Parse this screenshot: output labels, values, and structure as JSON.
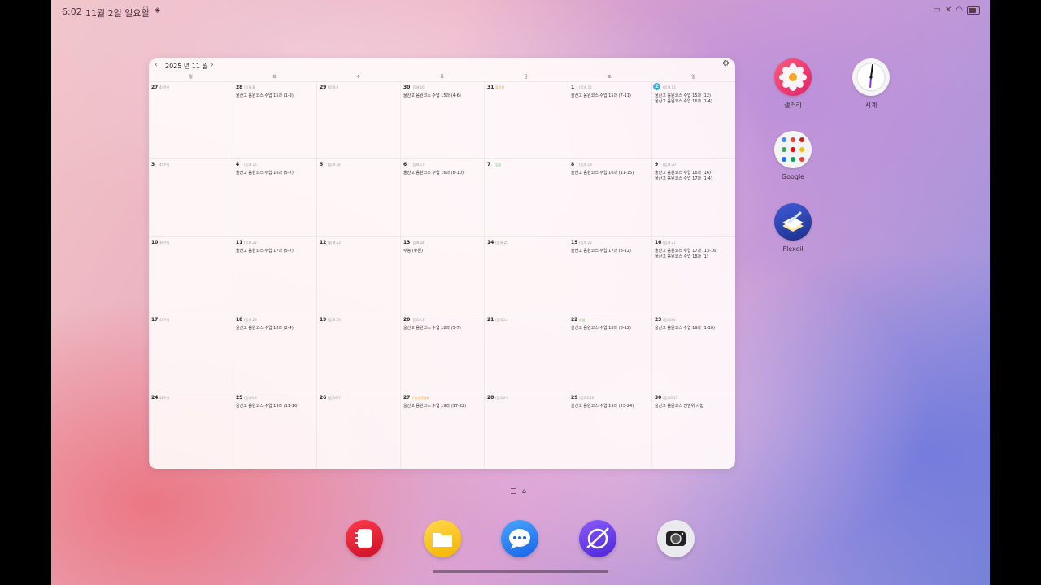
{
  "status": {
    "time": "6:02",
    "date": "11월 2일 일요일"
  },
  "calendar": {
    "title": "2025 년 11 월",
    "prev": "‹",
    "next": "›",
    "weekdays": [
      "월",
      "화",
      "수",
      "목",
      "금",
      "토",
      "일"
    ],
    "weeks": [
      [
        {
          "day": "27",
          "sub": "44주차",
          "events": []
        },
        {
          "day": "28",
          "sub": "(음)9.8",
          "events": [
            "울산고 음원코스 수업 15과 (1-3)"
          ]
        },
        {
          "day": "29",
          "sub": "(음)9.9",
          "events": []
        },
        {
          "day": "30",
          "sub": "(음)9.10",
          "events": [
            "울산고 음원코스 수업 15과 (4-6)"
          ]
        },
        {
          "day": "31",
          "sub": "할로윈",
          "events": []
        },
        {
          "day": "1",
          "sub": "(음)9.12",
          "events": [
            "울산고 음원코스 수업 15과 (7-11)"
          ]
        },
        {
          "day": "2",
          "sub": "(음)9.13",
          "events": [
            "울산고 음원코스 수업 15과 (12)",
            "울산고 음원코스 수업 16과 (1-4)"
          ],
          "today": true
        }
      ],
      [
        {
          "day": "3",
          "sub": "45주차",
          "events": []
        },
        {
          "day": "4",
          "sub": "(음)9.15",
          "events": [
            "울산고 음원코스 수업 16과 (5-7)"
          ]
        },
        {
          "day": "5",
          "sub": "(음)9.16",
          "events": []
        },
        {
          "day": "6",
          "sub": "(음)9.17",
          "events": [
            "울산고 음원코스 수업 16과 (8-10)"
          ]
        },
        {
          "day": "7",
          "sub": "입동",
          "events": []
        },
        {
          "day": "8",
          "sub": "(음)9.19",
          "events": [
            "울산고 음원코스 수업 16과 (11-15)"
          ]
        },
        {
          "day": "9",
          "sub": "(음)9.20",
          "events": [
            "울산고 음원코스 수업 16과 (16)",
            "울산고 음원코스 수업 17과 (1-4)"
          ]
        }
      ],
      [
        {
          "day": "10",
          "sub": "46주차",
          "events": []
        },
        {
          "day": "11",
          "sub": "(음)9.22",
          "events": [
            "울산고 음원코스 수업 17과 (5-7)"
          ]
        },
        {
          "day": "12",
          "sub": "(음)9.23",
          "events": []
        },
        {
          "day": "13",
          "sub": "(음)9.24",
          "events": [
            "수능 (휴원)"
          ]
        },
        {
          "day": "14",
          "sub": "(음)9.25",
          "events": []
        },
        {
          "day": "15",
          "sub": "(음)9.26",
          "events": [
            "울산고 음원코스 수업 17과 (8-12)"
          ]
        },
        {
          "day": "16",
          "sub": "(음)9.27",
          "events": [
            "울산고 음원코스 수업 17과 (13-16)",
            "울산고 음원코스 수업 18과 (1)"
          ]
        }
      ],
      [
        {
          "day": "17",
          "sub": "47주차",
          "events": []
        },
        {
          "day": "18",
          "sub": "(음)9.29",
          "events": [
            "울산고 음원코스 수업 18과 (2-4)"
          ]
        },
        {
          "day": "19",
          "sub": "(음)9.30",
          "events": []
        },
        {
          "day": "20",
          "sub": "(음)10.1",
          "events": [
            "울산고 음원코스 수업 18과 (5-7)"
          ]
        },
        {
          "day": "21",
          "sub": "(음)10.2",
          "events": []
        },
        {
          "day": "22",
          "sub": "소설",
          "events": [
            "울산고 음원코스 수업 18과 (8-12)"
          ]
        },
        {
          "day": "23",
          "sub": "(음)10.4",
          "events": [
            "울산고 음원코스 수업 19과 (1-10)"
          ]
        }
      ],
      [
        {
          "day": "24",
          "sub": "48주차",
          "events": []
        },
        {
          "day": "25",
          "sub": "(음)10.6",
          "events": [
            "울산고 음원코스 수업 19과 (11-16)"
          ]
        },
        {
          "day": "26",
          "sub": "(음)10.7",
          "events": []
        },
        {
          "day": "27",
          "sub": "수능성적발표",
          "events": [
            "울산고 음원코스 수업 19과 (17-22)"
          ]
        },
        {
          "day": "28",
          "sub": "(음)10.9",
          "events": []
        },
        {
          "day": "29",
          "sub": "(음)10.10",
          "events": [
            "울산고 음원코스 수업 19과 (23-24)"
          ]
        },
        {
          "day": "30",
          "sub": "(음)10.11",
          "events": [
            "울산고 음원코스 전범위 시험"
          ]
        }
      ]
    ]
  },
  "apps": [
    {
      "label": "갤러리",
      "icon": "gallery-icon"
    },
    {
      "label": "시계",
      "icon": "clock-icon"
    },
    {
      "label": "Google",
      "icon": "google-folder-icon"
    },
    {
      "label": "Flexcil",
      "icon": "flexcil-icon"
    }
  ],
  "dock": [
    "notes-icon",
    "files-icon",
    "messages-icon",
    "browser-icon",
    "camera-icon"
  ],
  "colors": {
    "today": "#3ab3e6",
    "holiday_orange": "#e8a23a",
    "solar_green": "#5cb85c"
  }
}
